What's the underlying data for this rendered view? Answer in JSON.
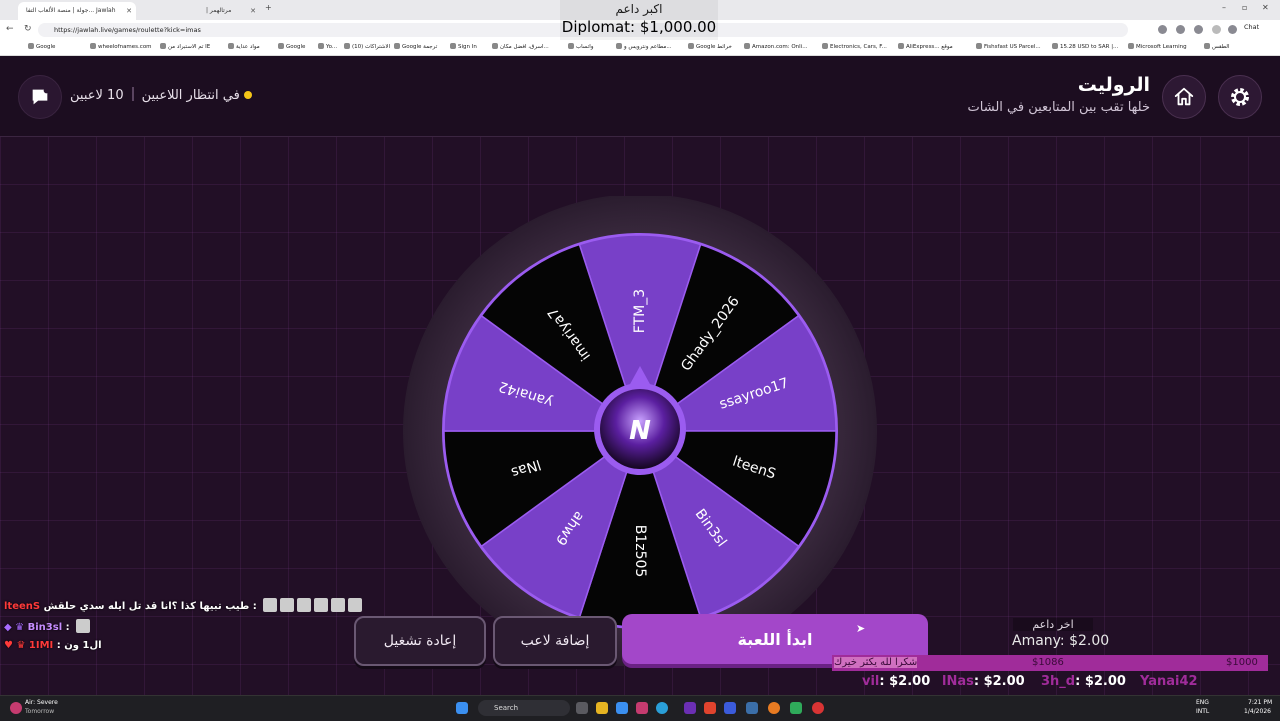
{
  "browser": {
    "tabs": [
      "جولة | منصة الألعاب التفا... Jawlah",
      "مرتالهمر | 13bhm.app"
    ],
    "url": "https://jawlah.live/games/roulette?kick=imas",
    "chat_label": "Chat",
    "bookmarks": [
      "Google",
      "wheelofnames.com",
      "تم الاستبراد من IE",
      "مواد عداية",
      "Google",
      "Yo...",
      "الاشتراكات (10)",
      "Google ترجمة",
      "Sign In",
      "اسرق، افضل مكان...",
      "واتساب",
      "مطاعم ونترويس و...",
      "Google خرائط",
      "Amazon.com: Onli...",
      "Electronics, Cars, F...",
      "AliExpress... موقع",
      "Fishsfast US Parcel...",
      "15.28 USD to SAR |...",
      "Microsoft Learning",
      "الطقس"
    ]
  },
  "stream_overlay": {
    "label": "اكبر داعم",
    "amount": "Diplomat: $1,000.00"
  },
  "header": {
    "title": "الروليت",
    "subtitle": "خلها تقب بين المتابعين في الشات",
    "players_count": "10 لاعبين",
    "status": "في انتظار اللاعبين"
  },
  "wheel": {
    "segments": [
      "FTM_3",
      "Ghady_2026",
      "ssayroo17",
      "lteenS",
      "Bin3sl",
      "B1z505",
      "ahw9",
      "lNas",
      "yanai42",
      "imariya7"
    ],
    "colors": {
      "purple": "#7840c8",
      "black": "#050505",
      "ring": "#2f2133",
      "accent": "#9b5cf0"
    },
    "center_letter": "N"
  },
  "chat": [
    {
      "user": "lteenS",
      "message": "طيب تبيها كذا ؟انا قد تل ايله سدي حلقش :",
      "color": "#ff3a3a"
    },
    {
      "user": "Bin3sl",
      "message": ":",
      "color": "#c78dff"
    },
    {
      "user": "1IMI",
      "message": ": ال1 ون",
      "color": "#ff3a3a"
    }
  ],
  "buttons": {
    "start": "ابدأ اللعبة",
    "add_player": "إضافة لاعب",
    "restart": "إعادة تشغيل"
  },
  "donations": {
    "last_label": "اخر داعم",
    "last_value": "Amany: $2.00",
    "goal_text": "شكرا لله يكثر خيرك",
    "goal_current": "$1086",
    "goal_target": "$1000",
    "recent": [
      {
        "name": "vil",
        "amount": ": $2.00"
      },
      {
        "name": "lNas",
        "amount": ": $2.00"
      },
      {
        "name": "3h_d",
        "amount": ": $2.00"
      },
      {
        "name": "Yanai42",
        "amount": ""
      }
    ]
  },
  "taskbar": {
    "weather_title": "Air: Severe",
    "weather_sub": "Tomorrow",
    "search": "Search",
    "lang1": "ENG",
    "lang2": "INTL",
    "time": "7:21 PM",
    "date": "1/4/2026"
  }
}
